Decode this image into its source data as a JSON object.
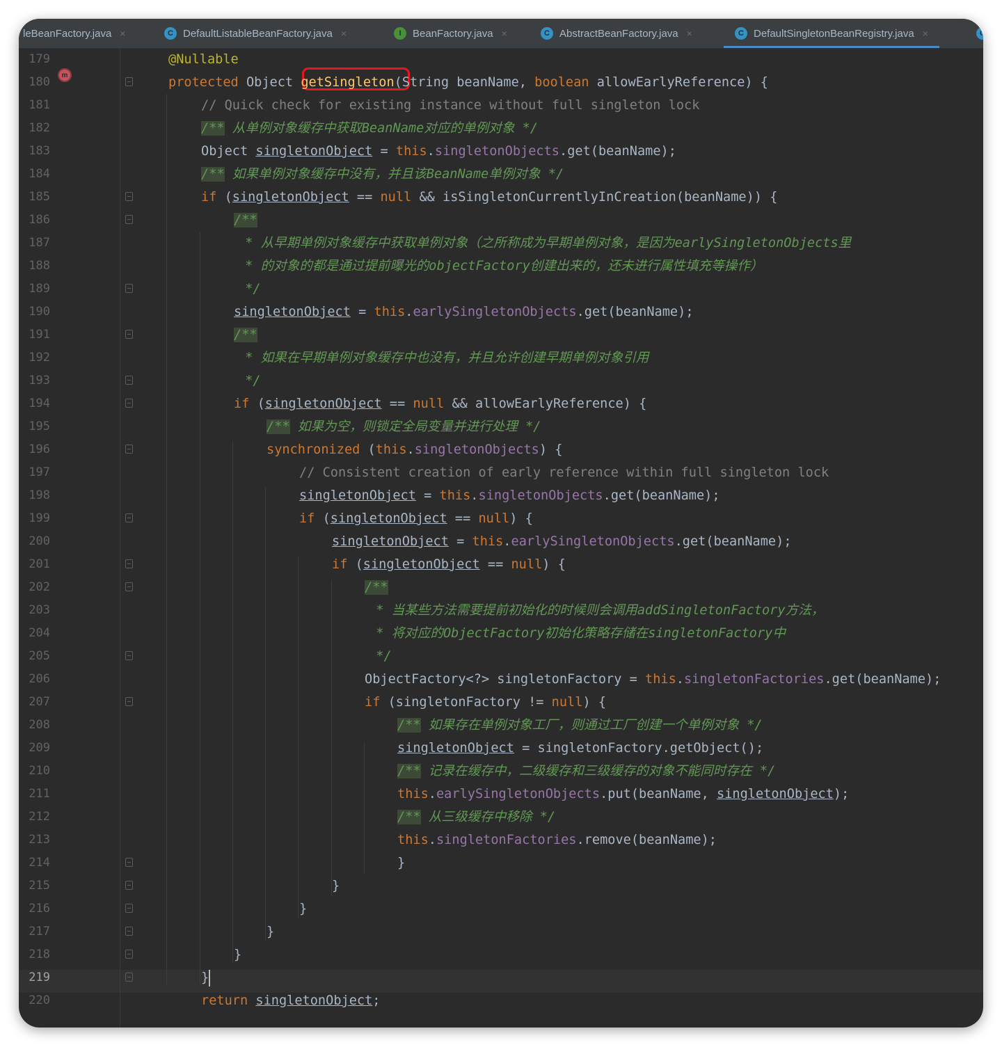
{
  "tabs": [
    {
      "label": "leBeanFactory.java",
      "icon": "class-icon"
    },
    {
      "label": "DefaultListableBeanFactory.java",
      "icon": "class-icon"
    },
    {
      "label": "BeanFactory.java",
      "icon": "interface-icon"
    },
    {
      "label": "AbstractBeanFactory.java",
      "icon": "abstract-class-icon"
    },
    {
      "label": "DefaultSingletonBeanRegistry.java",
      "icon": "class-icon",
      "active": true
    }
  ],
  "icon_letters": {
    "class": "C",
    "interface": "I",
    "overflow": "C"
  },
  "close_glyph": "×",
  "colors": {
    "editor_background": "#2b2b2b",
    "keyword": "#cc7832",
    "annotation": "#bbb529",
    "comment": "#808080",
    "doc_comment": "#629755",
    "field": "#9876aa",
    "method_declaration": "#ffc66d",
    "highlight_box": "#e8171d"
  },
  "current_line": 219,
  "lines": [
    {
      "n": "179",
      "t": "@Nullable"
    },
    {
      "n": "180",
      "t": "protected Object getSingleton(String beanName, boolean allowEarlyReference) {"
    },
    {
      "n": "181",
      "t": "// Quick check for existing instance without full singleton lock"
    },
    {
      "n": "182",
      "t": "/** 从单例对象缓存中获取BeanName对应的单例对象 */"
    },
    {
      "n": "183",
      "t": "Object singletonObject = this.singletonObjects.get(beanName);"
    },
    {
      "n": "184",
      "t": "/** 如果单例对象缓存中没有，并且该BeanName单例对象 */"
    },
    {
      "n": "185",
      "t": "if (singletonObject == null && isSingletonCurrentlyInCreation(beanName)) {"
    },
    {
      "n": "186",
      "t": "/**"
    },
    {
      "n": "187",
      "t": " * 从早期单例对象缓存中获取单例对象（之所称成为早期单例对象，是因为earlySingletonObjects里"
    },
    {
      "n": "188",
      "t": " * 的对象的都是通过提前曝光的objectFactory创建出来的，还未进行属性填充等操作）"
    },
    {
      "n": "189",
      "t": " */"
    },
    {
      "n": "190",
      "t": "singletonObject = this.earlySingletonObjects.get(beanName);"
    },
    {
      "n": "191",
      "t": "/**"
    },
    {
      "n": "192",
      "t": " * 如果在早期单例对象缓存中也没有，并且允许创建早期单例对象引用"
    },
    {
      "n": "193",
      "t": " */"
    },
    {
      "n": "194",
      "t": "if (singletonObject == null && allowEarlyReference) {"
    },
    {
      "n": "195",
      "t": "/** 如果为空，则锁定全局变量并进行处理 */"
    },
    {
      "n": "196",
      "t": "synchronized (this.singletonObjects) {"
    },
    {
      "n": "197",
      "t": "// Consistent creation of early reference within full singleton lock"
    },
    {
      "n": "198",
      "t": "singletonObject = this.singletonObjects.get(beanName);"
    },
    {
      "n": "199",
      "t": "if (singletonObject == null) {"
    },
    {
      "n": "200",
      "t": "singletonObject = this.earlySingletonObjects.get(beanName);"
    },
    {
      "n": "201",
      "t": "if (singletonObject == null) {"
    },
    {
      "n": "202",
      "t": "/**"
    },
    {
      "n": "203",
      "t": " * 当某些方法需要提前初始化的时候则会调用addSingletonFactory方法，"
    },
    {
      "n": "204",
      "t": " * 将对应的ObjectFactory初始化策略存储在singletonFactory中"
    },
    {
      "n": "205",
      "t": " */"
    },
    {
      "n": "206",
      "t": "ObjectFactory<?> singletonFactory = this.singletonFactories.get(beanName);"
    },
    {
      "n": "207",
      "t": "if (singletonFactory != null) {"
    },
    {
      "n": "208",
      "t": "/** 如果存在单例对象工厂，则通过工厂创建一个单例对象 */"
    },
    {
      "n": "209",
      "t": "singletonObject = singletonFactory.getObject();"
    },
    {
      "n": "210",
      "t": "/** 记录在缓存中，二级缓存和三级缓存的对象不能同时存在 */"
    },
    {
      "n": "211",
      "t": "this.earlySingletonObjects.put(beanName, singletonObject);"
    },
    {
      "n": "212",
      "t": "/** 从三级缓存中移除 */"
    },
    {
      "n": "213",
      "t": "this.singletonFactories.remove(beanName);"
    },
    {
      "n": "214",
      "t": "}"
    },
    {
      "n": "215",
      "t": "}"
    },
    {
      "n": "216",
      "t": "}"
    },
    {
      "n": "217",
      "t": "}"
    },
    {
      "n": "218",
      "t": "}"
    },
    {
      "n": "219",
      "t": "}"
    },
    {
      "n": "220",
      "t": "return singletonObject;"
    }
  ]
}
